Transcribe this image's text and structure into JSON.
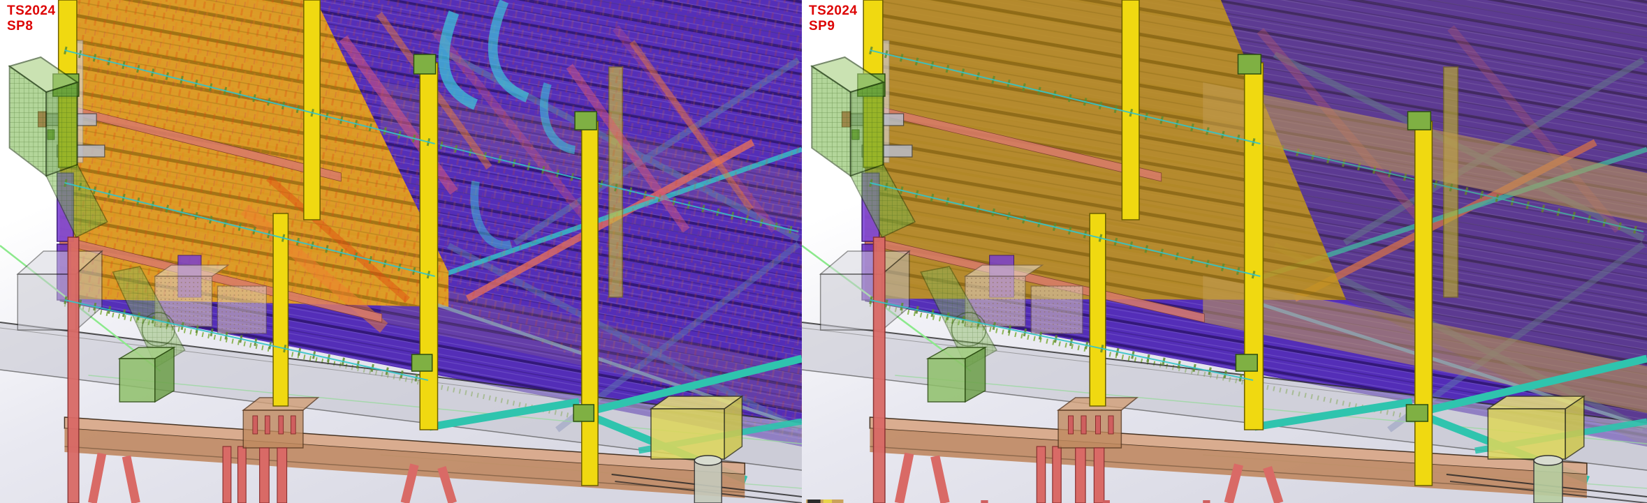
{
  "panels": [
    {
      "label_line1": "TS2024",
      "label_line2": "SP8"
    },
    {
      "label_line1": "TS2024",
      "label_line2": "SP9"
    }
  ],
  "colors": {
    "label_red": "#dd0404",
    "bg_top": "#ffffff",
    "bg_bottom": "#d7d7e2",
    "deck_purple": "#4a22b4",
    "deck_rib_dark": "#1e0b52",
    "wall_orange_sp8": "#e6a41c",
    "wall_olive_sp9": "#c0951f",
    "wall_rib_dark": "#6b4e04",
    "column_yellow": "#f0d911",
    "column_edge": "#6b5e00",
    "salmon_red": "#d96a66",
    "floor_edge_salmon": "#d97b6a",
    "brace_teal": "#2fc4ae",
    "brace_cyan": "#3ec2d8",
    "brace_slate": "#5d6fae",
    "streak_pink": "#e05878",
    "streak_orange": "#f08030",
    "mesh_green": "#76b548",
    "box_green": "#8fc06a",
    "joint_green": "#7fb043",
    "slab_gray": "#c2c3cd",
    "beam_brown_top": "#d9a888",
    "beam_brown_front": "#c08a64",
    "footing_tan": "#c08a5f",
    "box_yellow": "#ded75a",
    "tan_band": "#c09a55",
    "purple_column": "#8046d6",
    "construction_green": "#8ce98c"
  },
  "scene": {
    "elements": [
      "steel-frame",
      "metal-deck-floors",
      "shear-stud-rows",
      "diagonal-braces",
      "mesh-hopper",
      "mesh-chute",
      "grade-beam",
      "pile-foundations",
      "footing-block",
      "construction-lines",
      "equipment-boxes"
    ]
  }
}
